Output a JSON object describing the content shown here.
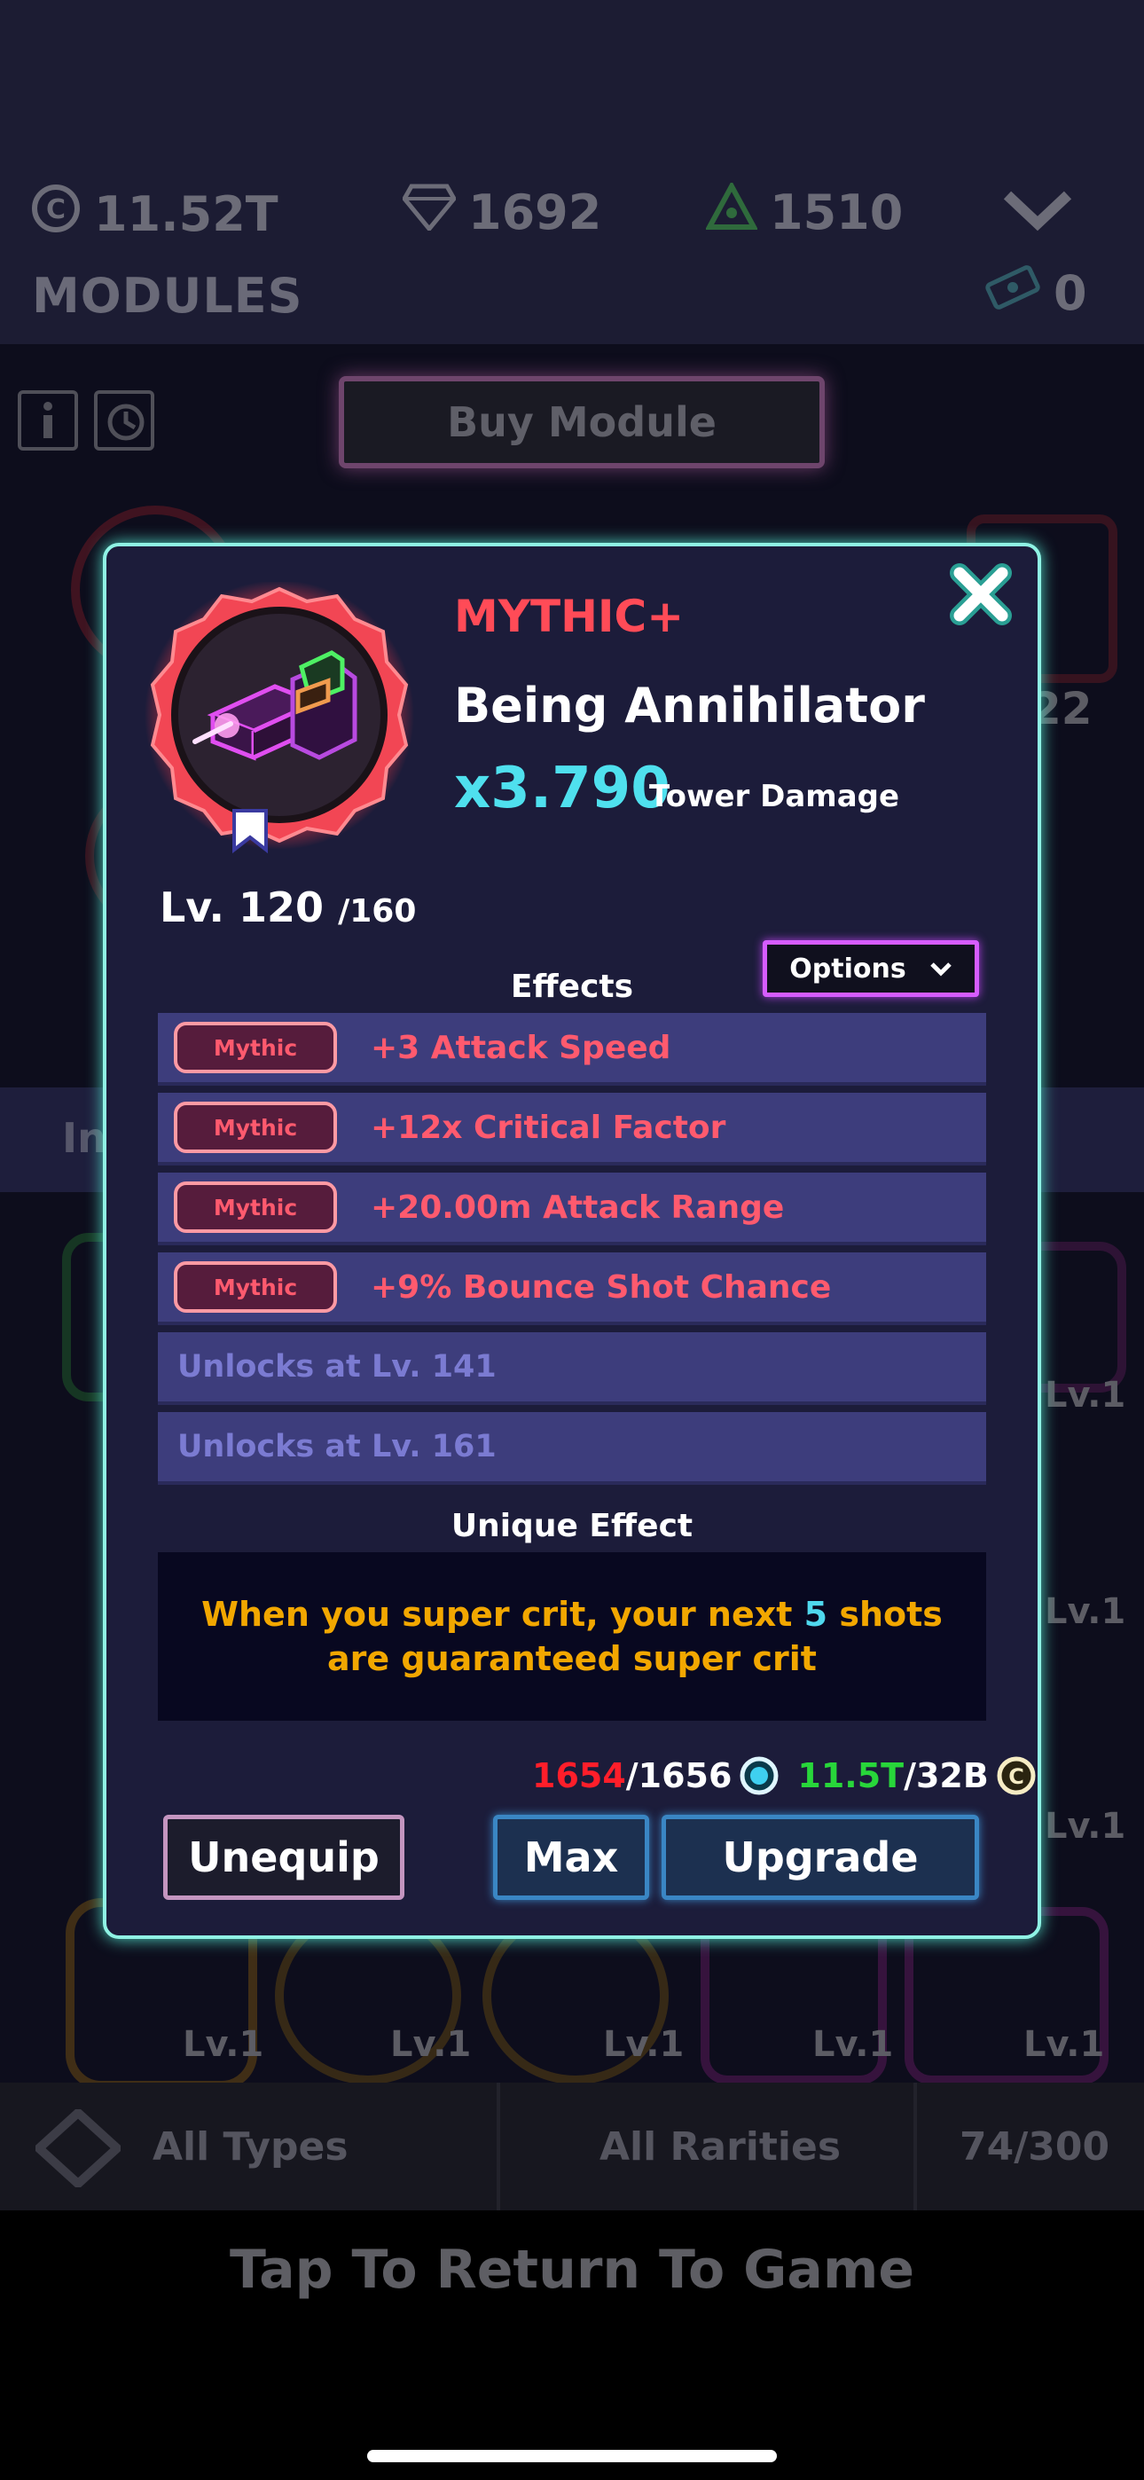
{
  "header": {
    "coins": "11.52T",
    "gems": "1692",
    "stones": "1510",
    "title": "MODULES",
    "tickets": "0"
  },
  "buy_module_label": "Buy Module",
  "background_tab_partial": "In",
  "background_levels": [
    "Lv.1",
    "Lv.1",
    "Lv.1",
    "Lv.1",
    "Lv.1",
    "Lv.1",
    "Lv.1",
    "Lv.1",
    "Lv.1",
    "22"
  ],
  "filters": {
    "types": "All Types",
    "rarities": "All Rarities",
    "count": "74/300"
  },
  "return_label": "Tap To Return To Game",
  "module": {
    "rarity": "MYTHIC+",
    "name": "Being Annihilator",
    "multiplier": "x3.790",
    "multiplier_label": "Tower Damage",
    "level": "Lv. 120",
    "level_max": "/160"
  },
  "effects_heading": "Effects",
  "options_label": "Options",
  "effects": [
    {
      "badge": "Mythic",
      "text": "+3 Attack Speed"
    },
    {
      "badge": "Mythic",
      "text": "+12x Critical Factor"
    },
    {
      "badge": "Mythic",
      "text": "+20.00m Attack Range"
    },
    {
      "badge": "Mythic",
      "text": "+9% Bounce Shot Chance"
    }
  ],
  "locked_effects": [
    "Unlocks at Lv. 141",
    "Unlocks at Lv. 161"
  ],
  "unique_heading": "Unique Effect",
  "unique_effect": {
    "pre": "When you super crit, your next ",
    "num": "5",
    "post": " shots are guaranteed super crit"
  },
  "cost": {
    "shards_have": "1654",
    "shards_need": "/1656",
    "coins_have": "11.5T",
    "coins_need": "/32B"
  },
  "buttons": {
    "unequip": "Unequip",
    "max": "Max",
    "upgrade": "Upgrade"
  },
  "colors": {
    "mythic_red": "#ff4b57",
    "modal_border": "#8ff3e4",
    "unique_text": "#f2a700",
    "highlight_cyan": "#4fd8ee"
  }
}
